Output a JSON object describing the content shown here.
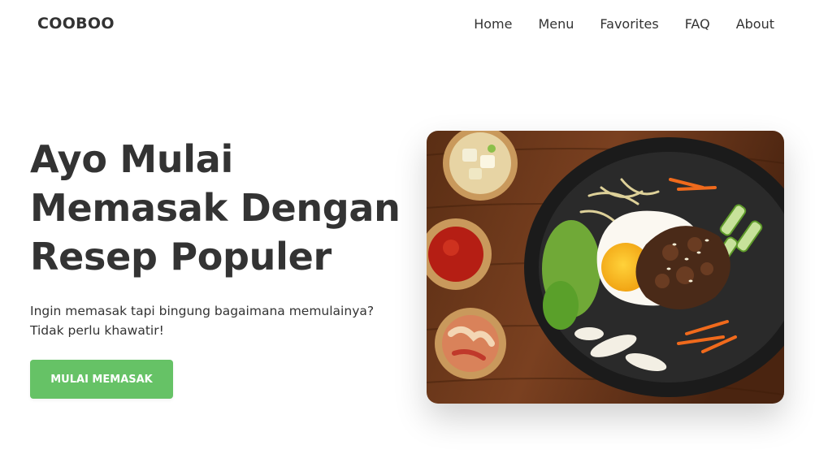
{
  "nav": {
    "brand": "COOBOO",
    "links": [
      "Home",
      "Menu",
      "Favorites",
      "FAQ",
      "About"
    ]
  },
  "hero": {
    "title_lines": [
      "Ayo Mulai",
      "Memasak Dengan",
      "Resep Populer"
    ],
    "description_lines": [
      "Ingin memasak tapi bingung bagaimana memulainya?",
      "Tidak perlu khawatir!"
    ],
    "cta_label": "MULAI MEMASAK"
  },
  "colors": {
    "accent": "#66c266",
    "text": "#333333",
    "background": "#ffffff"
  }
}
